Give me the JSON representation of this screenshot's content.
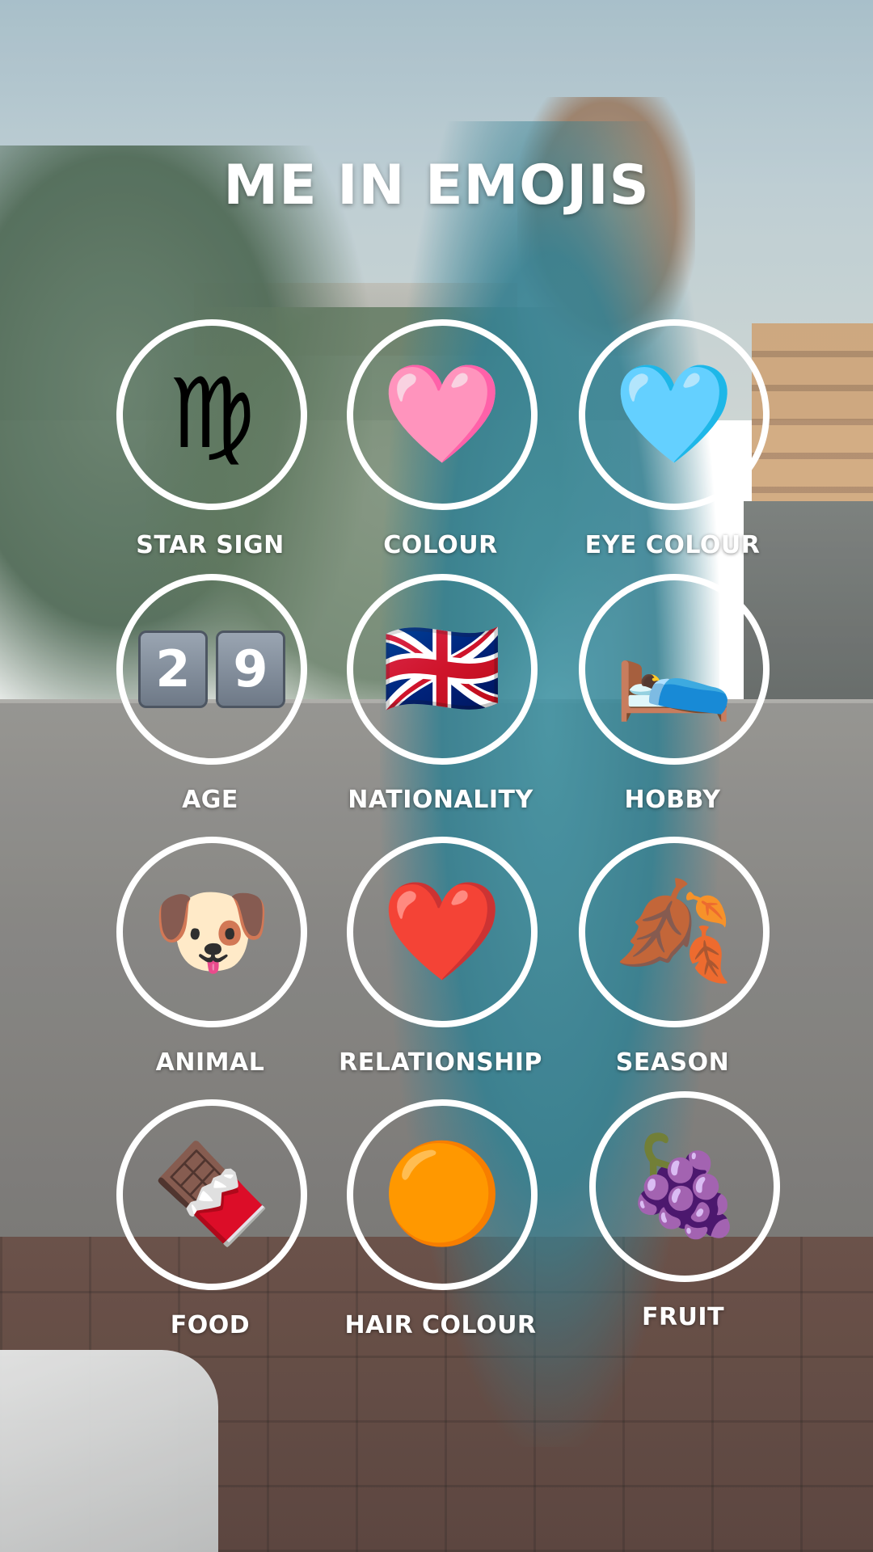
{
  "title": "ME IN EMOJIS",
  "items": [
    {
      "label": "STAR SIGN",
      "emoji": "♍",
      "icon": "virgo-icon"
    },
    {
      "label": "COLOUR",
      "emoji": "🩷",
      "icon": "pink-heart-icon"
    },
    {
      "label": "EYE COLOUR",
      "emoji": "🩵",
      "icon": "light-blue-heart-icon"
    },
    {
      "label": "AGE",
      "digits": [
        "2",
        "9"
      ],
      "icon": "keycap-digits-icon"
    },
    {
      "label": "NATIONALITY",
      "emoji": "🇬🇧",
      "icon": "uk-flag-icon"
    },
    {
      "label": "HOBBY",
      "emoji": "🛌",
      "icon": "person-in-bed-icon"
    },
    {
      "label": "ANIMAL",
      "emoji": "🐶",
      "icon": "dog-face-icon"
    },
    {
      "label": "RELATIONSHIP",
      "emoji": "❤️",
      "icon": "red-heart-icon"
    },
    {
      "label": "SEASON",
      "emoji": "🍂",
      "icon": "fallen-leaves-icon"
    },
    {
      "label": "FOOD",
      "emoji": "🍫",
      "icon": "chocolate-bar-icon"
    },
    {
      "label": "HAIR COLOUR",
      "emoji": "🟠",
      "icon": "orange-circle-icon"
    },
    {
      "label": "FRUIT",
      "emoji": "🍇",
      "icon": "grapes-icon"
    }
  ],
  "colors": {
    "ring": "#ffffff",
    "text": "#ffffff"
  }
}
